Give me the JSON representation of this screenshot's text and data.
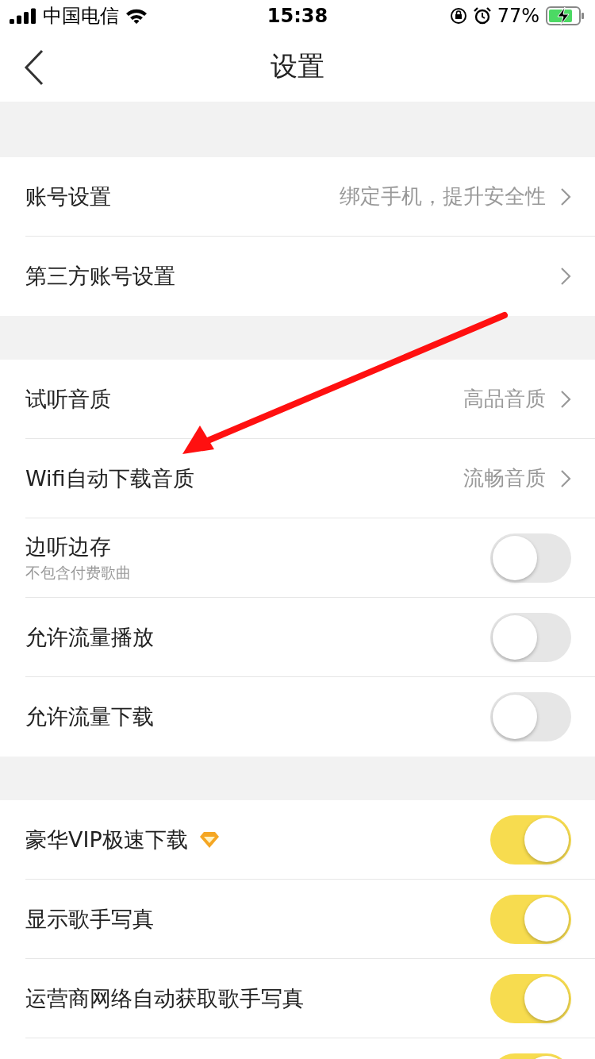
{
  "status_bar": {
    "carrier": "中国电信",
    "time": "15:38",
    "battery": "77%",
    "charging": true
  },
  "nav": {
    "title": "设置"
  },
  "groups": [
    {
      "rows": [
        {
          "kind": "link",
          "label": "账号设置",
          "value": "绑定手机，提升安全性"
        },
        {
          "kind": "link",
          "label": "第三方账号设置"
        }
      ]
    },
    {
      "rows": [
        {
          "kind": "link",
          "label": "试听音质",
          "value": "高品音质"
        },
        {
          "kind": "link",
          "label": "Wifi自动下载音质",
          "value": "流畅音质"
        },
        {
          "kind": "toggle",
          "label": "边听边存",
          "sub": "不包含付费歌曲",
          "on": false
        },
        {
          "kind": "toggle",
          "label": "允许流量播放",
          "on": false
        },
        {
          "kind": "toggle",
          "label": "允许流量下载",
          "on": false
        }
      ]
    },
    {
      "rows": [
        {
          "kind": "toggle",
          "label": "豪华VIP极速下载",
          "vip": true,
          "on": true
        },
        {
          "kind": "toggle",
          "label": "显示歌手写真",
          "on": true
        },
        {
          "kind": "toggle",
          "label": "运营商网络自动获取歌手写真",
          "on": true
        },
        {
          "kind": "toggle",
          "on": true
        }
      ]
    }
  ],
  "annotation": {
    "kind": "arrow"
  }
}
